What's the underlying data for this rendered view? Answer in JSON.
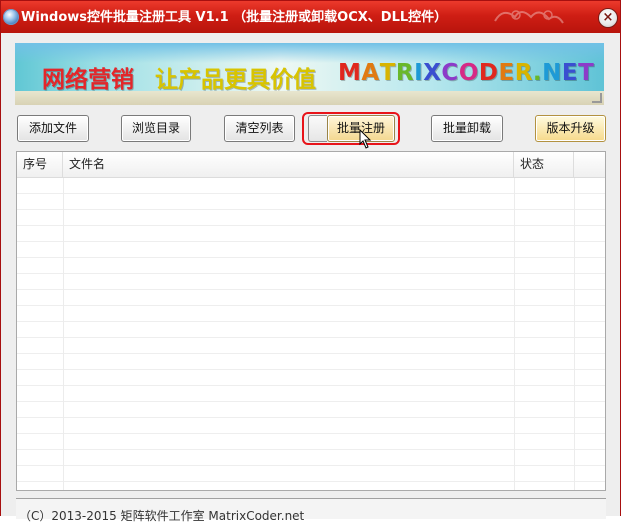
{
  "window": {
    "title": "Windows控件批量注册工具 V1.1 （批量注册或卸载OCX、DLL控件）",
    "close_label": "×"
  },
  "banner": {
    "text1": "网络营销",
    "text2": "让产品更具价值",
    "text3": "MATRIXCODER.NET"
  },
  "toolbar": {
    "add_file": "添加文件",
    "browse_dir": "浏览目录",
    "clear_list": "清空列表",
    "batch_register": "批量注册",
    "batch_unregister": "批量卸载",
    "upgrade": "版本升级"
  },
  "table": {
    "columns": [
      "序号",
      "文件名",
      "状态",
      ""
    ],
    "rows": []
  },
  "status": {
    "copyright": "（C）2013-2015 矩阵软件工作室 MatrixCoder.net"
  },
  "colors": {
    "title_bar": "#cf1e14",
    "highlight": "#e8141a",
    "banner_red": "#e3262a",
    "banner_yellow": "#d8c400"
  }
}
